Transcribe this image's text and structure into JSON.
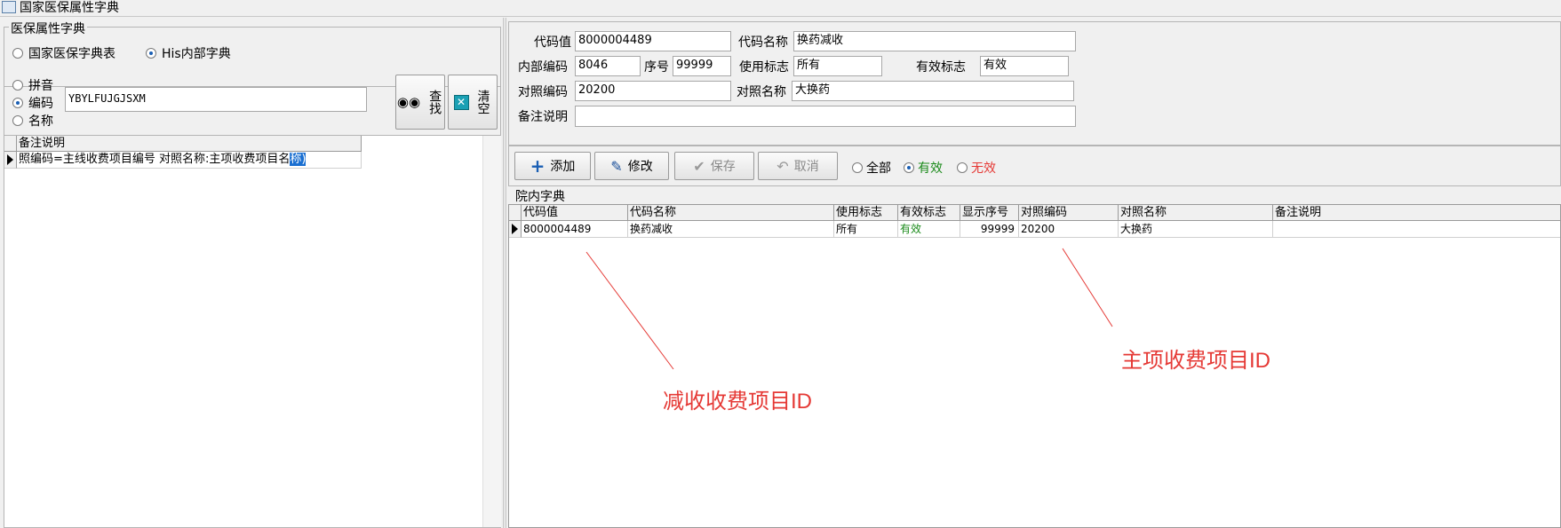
{
  "window": {
    "title": "国家医保属性字典"
  },
  "left": {
    "group_title": "医保属性字典",
    "dict_options": [
      {
        "label": "国家医保字典表",
        "selected": false
      },
      {
        "label": "His内部字典",
        "selected": true
      }
    ],
    "search_modes": [
      {
        "label": "拼音",
        "selected": false
      },
      {
        "label": "编码",
        "selected": true
      },
      {
        "label": "名称",
        "selected": false
      }
    ],
    "search_value": "YBYLFUJGJSXM",
    "find_button": "查找",
    "clear_button": "清空",
    "grid": {
      "header": "备注说明",
      "rows": [
        {
          "text": "照编码=主线收费项目编号 对照名称:主项收费项目名",
          "selected_tail": "称)"
        }
      ]
    }
  },
  "form": {
    "code_label": "代码值",
    "code_value": "8000004489",
    "name_label": "代码名称",
    "name_value": "换药减收",
    "internal_label": "内部编码",
    "internal_value": "8046",
    "seq_label": "序号",
    "seq_value": "99999",
    "usage_label": "使用标志",
    "usage_value": "所有",
    "valid_label": "有效标志",
    "valid_value": "有效",
    "ref_code_label": "对照编码",
    "ref_code_value": "20200",
    "ref_name_label": "对照名称",
    "ref_name_value": "大换药",
    "remark_label": "备注说明",
    "remark_value": ""
  },
  "toolbar": {
    "add": "添加",
    "edit": "修改",
    "save": "保存",
    "cancel": "取消",
    "filters": [
      {
        "label": "全部",
        "selected": false,
        "color": "#000000"
      },
      {
        "label": "有效",
        "selected": true,
        "color": "#1a8a1a"
      },
      {
        "label": "无效",
        "selected": false,
        "color": "#e53935"
      }
    ]
  },
  "table": {
    "title": "院内字典",
    "columns": [
      "代码值",
      "代码名称",
      "使用标志",
      "有效标志",
      "显示序号",
      "对照编码",
      "对照名称",
      "备注说明"
    ],
    "rows": [
      [
        "8000004489",
        "换药减收",
        "所有",
        "有效",
        "99999",
        "20200",
        "大换药",
        ""
      ]
    ],
    "valid_color": "#1a8a1a"
  },
  "annotations": {
    "left_note": "减收收费项目ID",
    "right_note": "主项收费项目ID",
    "color": "#e53935"
  }
}
